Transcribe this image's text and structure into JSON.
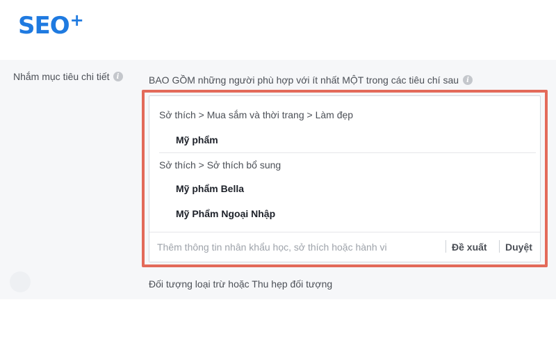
{
  "logo": {
    "text": "SEO",
    "plus": "+"
  },
  "targeting": {
    "label": "Nhắm mục tiêu chi tiết",
    "include_heading": "BAO GỒM những người phù hợp với ít nhất MỘT trong các tiêu chí sau",
    "groups": [
      {
        "path": "Sở thích > Mua sắm và thời trang > Làm đẹp",
        "items": [
          "Mỹ phẩm"
        ]
      },
      {
        "path": "Sở thích > Sở thích bổ sung",
        "items": [
          "Mỹ phẩm Bella",
          "Mỹ Phẩm Ngoại Nhập"
        ]
      }
    ],
    "search_placeholder": "Thêm thông tin nhân khẩu học, sở thích hoặc hành vi",
    "suggest_label": "Đề xuất",
    "browse_label": "Duyệt",
    "exclude_link": "Đối tượng loại trừ hoặc Thu hẹp đối tượng"
  },
  "colors": {
    "brand": "#1f7ae0",
    "highlight_border": "#e36a5a",
    "panel_bg": "#f6f7f9"
  }
}
